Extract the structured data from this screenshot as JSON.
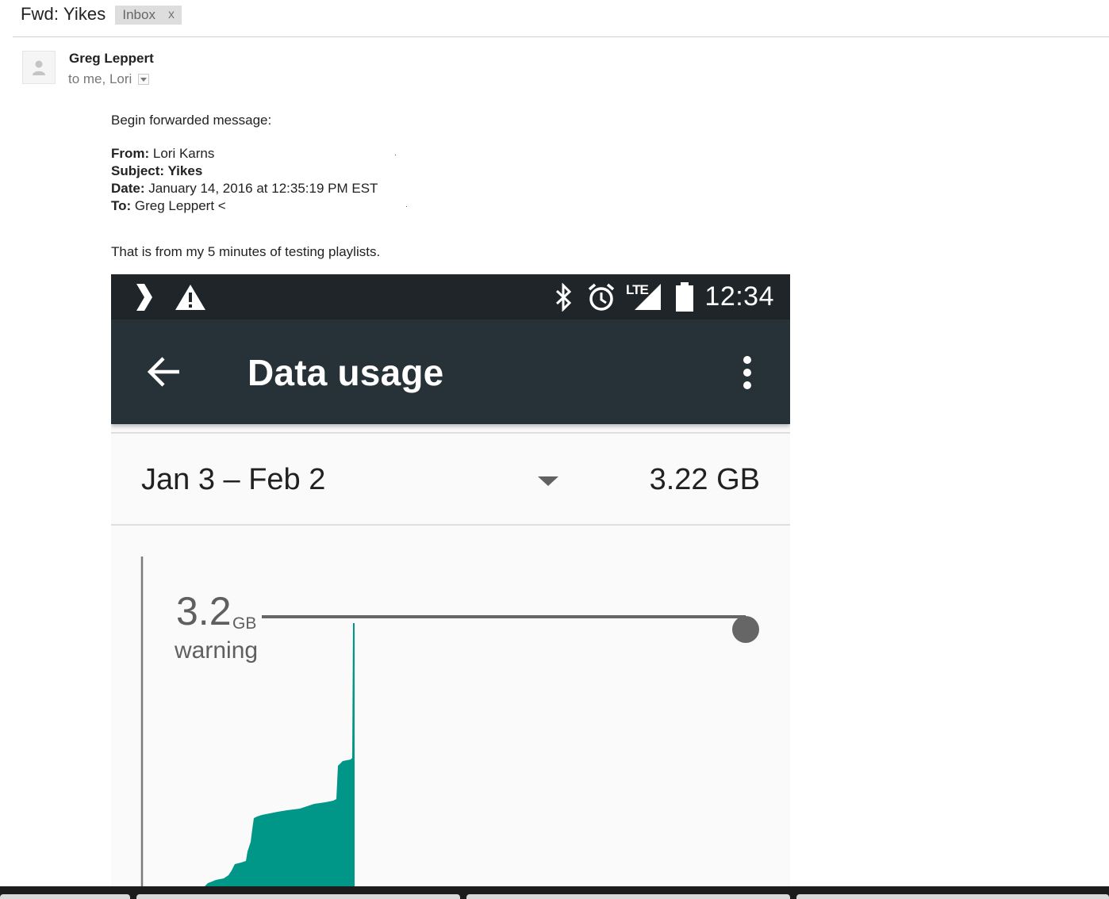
{
  "email": {
    "subject": "Fwd: Yikes",
    "label": "Inbox",
    "label_remove": "x",
    "sender": "Greg Leppert",
    "recipients": "to me, Lori"
  },
  "body": {
    "intro": "Begin forwarded message:",
    "from_label": "From:",
    "from_value": " Lori Karns",
    "subject_label": "Subject:",
    "subject_value": " Yikes",
    "date_label": "Date:",
    "date_value": " January 14, 2016 at 12:35:19 PM EST",
    "to_label": "To:",
    "to_value": " Greg Leppert <",
    "message": "That is from my 5 minutes of testing playlists."
  },
  "phone": {
    "status_time": "12:34",
    "network_label": "LTE",
    "title": "Data usage",
    "cycle_range": "Jan 3 – Feb 2",
    "cycle_total": "3.22 GB",
    "warning_value": "3.2",
    "warning_unit": "GB",
    "warning_label": "warning",
    "warning_level_fraction": 1.0,
    "colors": {
      "status_bar": "#1f2528",
      "app_bar": "#263238",
      "usage_fill": "#009688",
      "limit_line": "#666666"
    },
    "icons": [
      "chevron-right-icon",
      "warning-icon",
      "bluetooth-icon",
      "alarm-icon",
      "signal-icon",
      "battery-icon",
      "back-arrow-icon",
      "overflow-menu-icon",
      "dropdown-arrow-icon"
    ]
  }
}
